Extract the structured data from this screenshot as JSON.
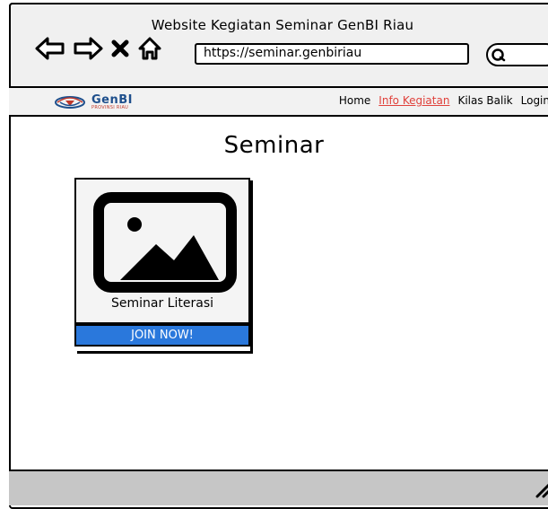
{
  "window": {
    "title": "Website Kegiatan Seminar GenBI Riau",
    "url": "https://seminar.genbiriau"
  },
  "browser_icons": [
    "back-arrow-icon",
    "forward-arrow-icon",
    "close-x-icon",
    "home-icon",
    "search-icon"
  ],
  "header": {
    "logo": {
      "name": "GenBI",
      "subtitle": "PROVINSI RIAU",
      "brand_color": "#1e4f8c",
      "accent_color": "#c0392b"
    },
    "nav": [
      {
        "label": "Home",
        "active": false
      },
      {
        "label": "Info Kegiatan",
        "active": true
      },
      {
        "label": "Kilas Balik",
        "active": false
      },
      {
        "label": "Login",
        "active": false
      }
    ]
  },
  "main": {
    "title": "Seminar",
    "cards": [
      {
        "label": "Seminar Literasi",
        "button_label": "JOIN NOW!",
        "image_icon": "image-placeholder-icon",
        "button_color": "#2a78dc"
      }
    ]
  },
  "colors": {
    "active_link": "#e0413b",
    "chrome_bg": "#f0f0f0",
    "status_bar_bg": "#c6c6c6"
  }
}
